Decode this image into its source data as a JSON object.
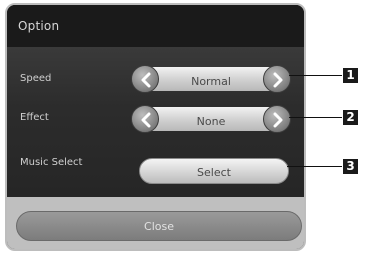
{
  "dialog": {
    "title": "Option",
    "speed": {
      "label": "Speed",
      "value": "Normal"
    },
    "effect": {
      "label": "Effect",
      "value": "None"
    },
    "music_select": {
      "label": "Music Select",
      "button": "Select"
    },
    "close_button": "Close"
  },
  "callouts": [
    "1",
    "2",
    "3"
  ]
}
